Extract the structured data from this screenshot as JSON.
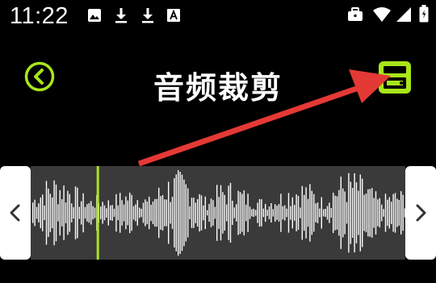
{
  "status_bar": {
    "time": "11:22",
    "icons_left": [
      "image-icon",
      "download-icon",
      "download-icon",
      "font-icon"
    ],
    "icons_right": [
      "briefcase-icon",
      "wifi-icon",
      "signal-icon",
      "battery-icon"
    ]
  },
  "title_bar": {
    "title": "音频裁剪",
    "back_icon": "chevron-left-circle-icon",
    "save_icon": "save-icon"
  },
  "waveform": {
    "left_handle_icon": "chevron-left-icon",
    "right_handle_icon": "chevron-right-icon",
    "playhead_position": 0.176
  },
  "colors": {
    "background": "#000000",
    "accent": "#a8e619",
    "annotation_arrow": "#e53935",
    "waveform_bg": "#3a3a3a",
    "waveform_bars": "#ffffff",
    "handle": "#ffffff"
  }
}
